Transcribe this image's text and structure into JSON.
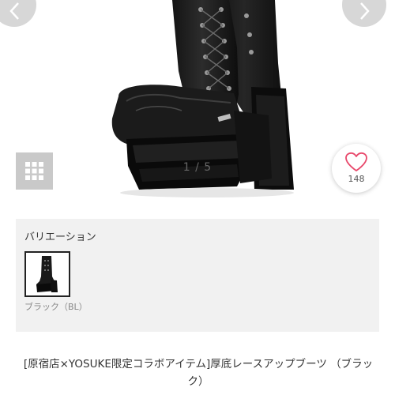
{
  "gallery": {
    "prev_icon": "chevron-left-icon",
    "next_icon": "chevron-right-icon",
    "grid_icon": "grid-icon",
    "counter": "1 / 5",
    "like_icon": "heart-outline-icon",
    "like_count": "148",
    "accent_color": "#e8486b"
  },
  "variation": {
    "title": "バリエーション",
    "items": [
      {
        "label": "ブラック（BL）",
        "selected": true
      }
    ]
  },
  "product": {
    "title": "[原宿店×YOSUKE限定コラボアイテム]厚底レースアップブーツ （ブラック）"
  }
}
